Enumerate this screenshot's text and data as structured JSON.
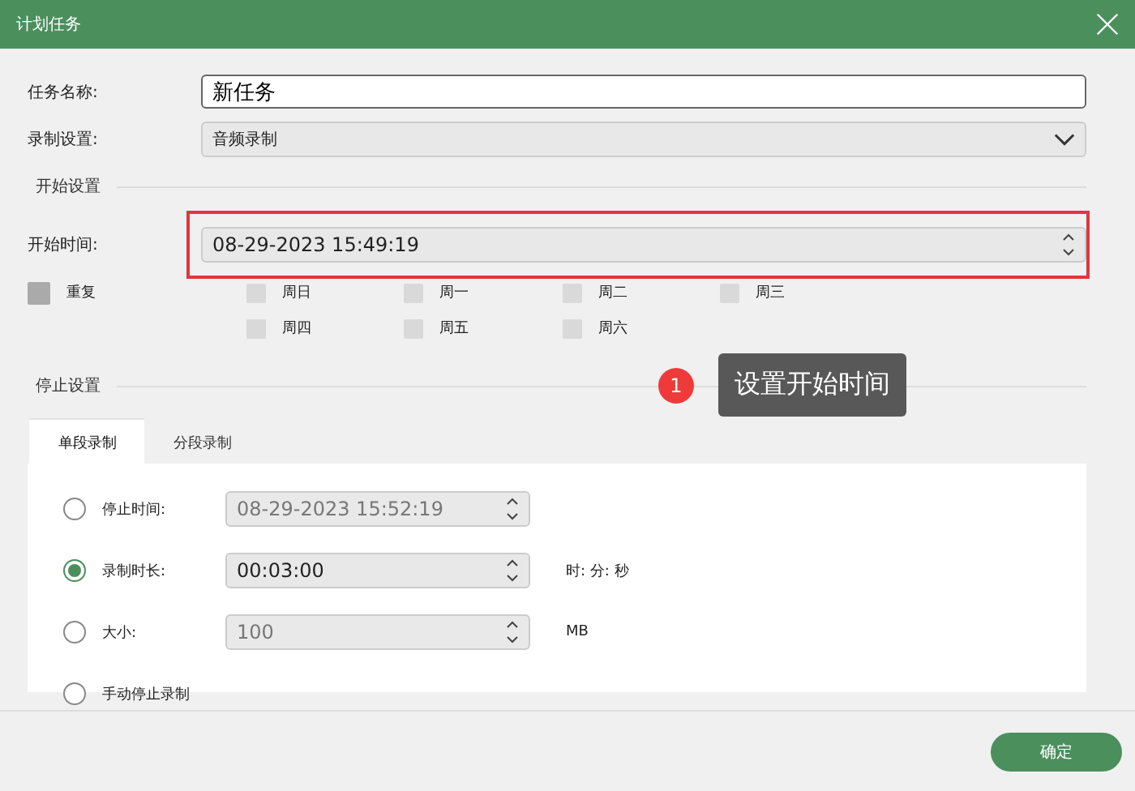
{
  "window": {
    "title": "计划任务"
  },
  "task_name": {
    "label": "任务名称:",
    "value": "新任务"
  },
  "record_setting": {
    "label": "录制设置:",
    "value": "音频录制"
  },
  "start_section": {
    "title": "开始设置",
    "label": "开始时间:",
    "value": "08-29-2023 15:49:19",
    "highlighted": true
  },
  "repeat": {
    "label": "重复",
    "checked": false
  },
  "weekdays": [
    {
      "label": "周日",
      "checked": false
    },
    {
      "label": "周一",
      "checked": false
    },
    {
      "label": "周二",
      "checked": false
    },
    {
      "label": "周三",
      "checked": false
    },
    {
      "label": "周四",
      "checked": false
    },
    {
      "label": "周五",
      "checked": false
    },
    {
      "label": "周六",
      "checked": false
    }
  ],
  "annotation": {
    "number": "1",
    "text": "设置开始时间"
  },
  "stop_section": {
    "title": "停止设置"
  },
  "tabs": [
    {
      "label": "单段录制",
      "selected": true
    },
    {
      "label": "分段录制",
      "selected": false
    }
  ],
  "stop_options": [
    {
      "label": "停止时间:",
      "value": "08-29-2023 15:52:19",
      "selected": false
    },
    {
      "label": "录制时长:",
      "value": "00:03:00",
      "unit": "时: 分: 秒",
      "selected": true
    },
    {
      "label": "大小:",
      "value": "100",
      "unit": "MB",
      "selected": false
    },
    {
      "label": "手动停止录制",
      "selected": false
    }
  ],
  "confirm_button": "确定"
}
